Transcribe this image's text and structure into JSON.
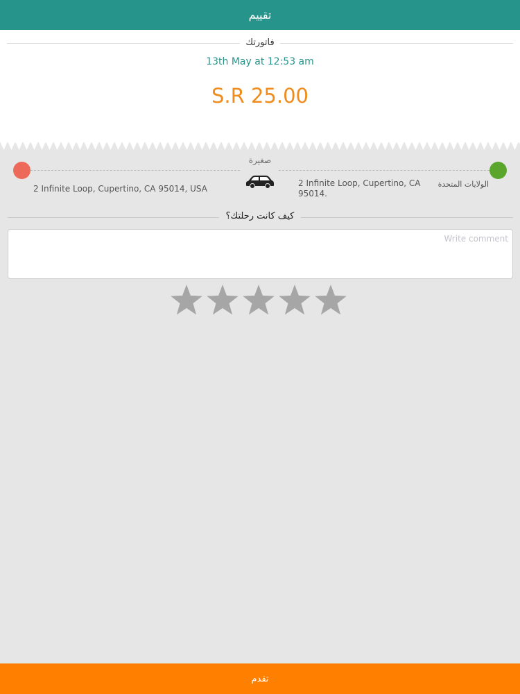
{
  "header": {
    "title": "تقييم"
  },
  "receipt": {
    "label": "فاتورتك",
    "date": "13th May at 12:53 am",
    "amount": "S.R 25.00"
  },
  "route": {
    "car_type": "صغيرة",
    "pickup_address": "2 Infinite Loop, Cupertino, CA 95014, USA",
    "dropoff_address_en": "2 Infinite Loop, Cupertino, CA 95014.",
    "dropoff_address_ar": "الولايات المتحدة",
    "pickup_color": "#ed6a5a",
    "dropoff_color": "#5aa62c"
  },
  "feedback": {
    "question": "كيف كانت رحلتك؟",
    "comment_placeholder": "Write comment",
    "comment_value": "",
    "rating": 0,
    "max_rating": 5
  },
  "footer": {
    "submit_label": "تقدم"
  },
  "colors": {
    "header": "#26948a",
    "accent": "#f08c1e",
    "submit": "#ff7f00"
  }
}
